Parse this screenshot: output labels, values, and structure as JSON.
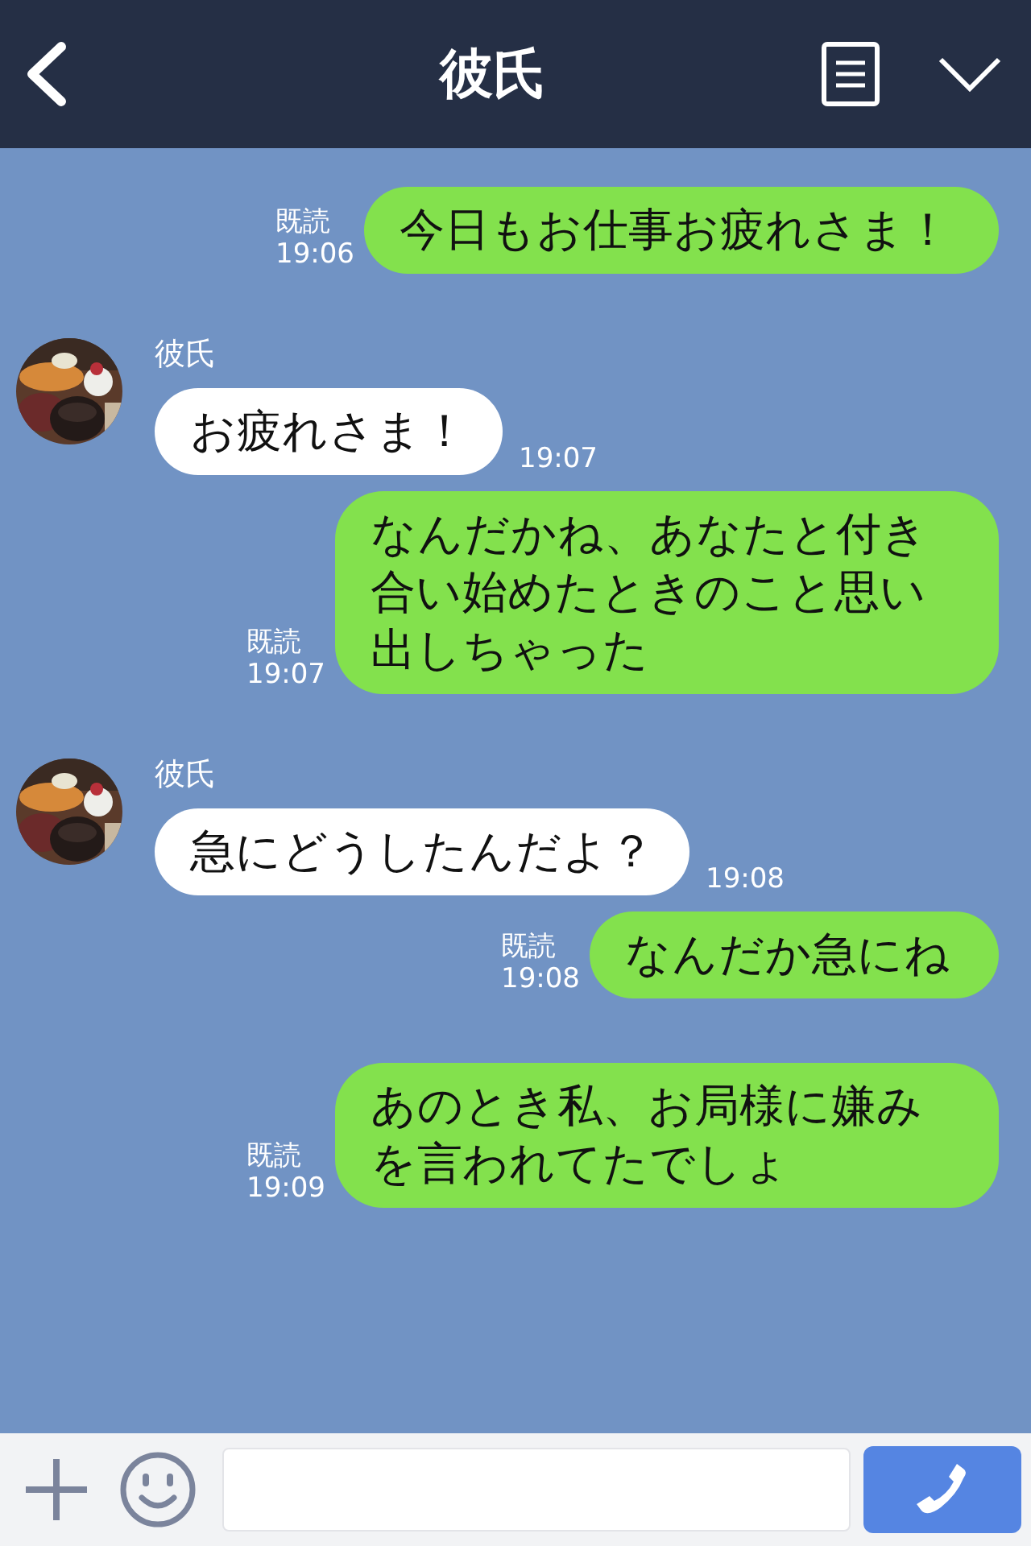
{
  "header": {
    "title": "彼氏"
  },
  "messages": [
    {
      "kind": "sent",
      "text": "今日もお仕事お疲れさま！",
      "read": "既読",
      "time": "19:06"
    },
    {
      "kind": "received",
      "sender": "彼氏",
      "text": "お疲れさま！",
      "time": "19:07"
    },
    {
      "kind": "sent",
      "text": "なんだかね、あなたと付き合い始めたときのこと思い出しちゃった",
      "read": "既読",
      "time": "19:07"
    },
    {
      "kind": "received",
      "sender": "彼氏",
      "text": "急にどうしたんだよ？",
      "time": "19:08"
    },
    {
      "kind": "sent",
      "text": "なんだか急にね",
      "read": "既読",
      "time": "19:08"
    },
    {
      "kind": "sent",
      "text": "あのとき私、お局様に嫌みを言われてたでしょ",
      "read": "既読",
      "time": "19:09"
    }
  ]
}
